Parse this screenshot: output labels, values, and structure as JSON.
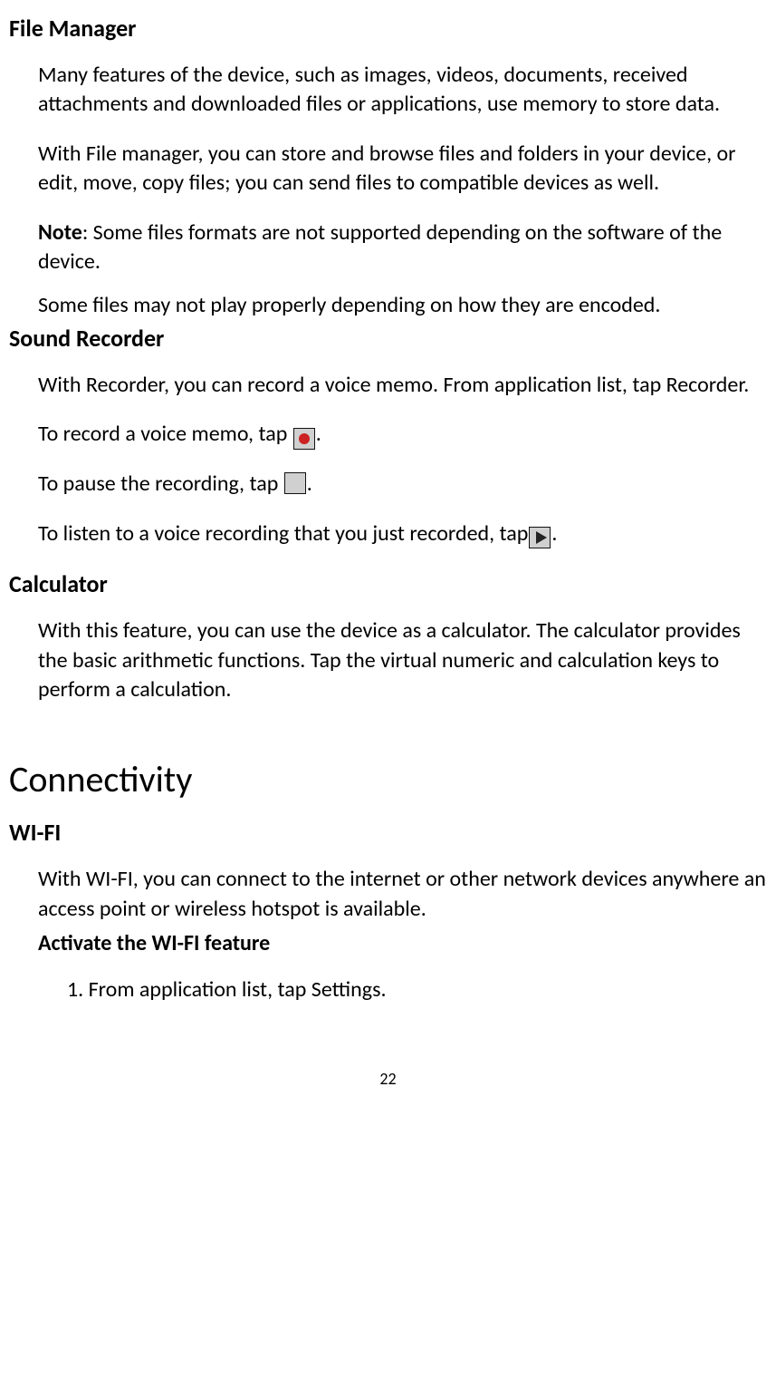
{
  "file_manager": {
    "heading": "File Manager",
    "p1": "Many features of the device, such as images, videos, documents, received attachments and downloaded files or applications, use memory to store data.",
    "p2": "With File manager, you can store and browse files and folders in your device, or edit, move, copy files; you can send files to compatible devices as well.",
    "note_label": "Note",
    "note_rest": ": Some files formats are not supported depending on the software of the device.",
    "p3": "Some files may not play properly depending on how they are encoded."
  },
  "sound_recorder": {
    "heading": "Sound Recorder",
    "p1": "With Recorder, you can record a voice memo. From application list, tap Recorder.",
    "rec_pre": "To record a voice memo, tap ",
    "rec_post": ".",
    "pause_pre": "To pause the recording, tap ",
    "pause_post": ".",
    "play_pre": "To listen to a voice recording that you just recorded, tap",
    "play_post": "."
  },
  "calculator": {
    "heading": "Calculator",
    "p1": "With this feature, you can use the device as a calculator. The calculator provides the basic arithmetic functions. Tap the virtual numeric and calculation keys to perform a calculation."
  },
  "connectivity": {
    "heading": "Connectivity",
    "wifi_heading": "WI-FI",
    "wifi_p1": "With WI-FI, you can connect to the internet or other network devices anywhere an access point or wireless hotspot is available.",
    "wifi_sub": "Activate the WI-FI feature",
    "step1": "1. From application list, tap Settings."
  },
  "page_number": "22"
}
